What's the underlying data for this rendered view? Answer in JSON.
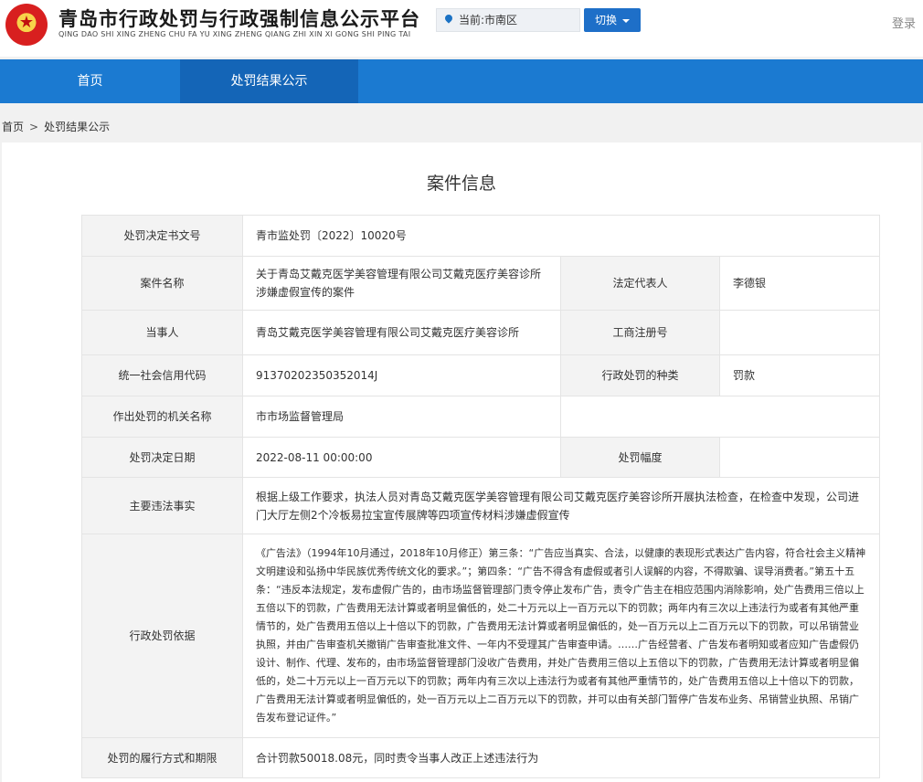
{
  "header": {
    "title": "青岛市行政处罚与行政强制信息公示平台",
    "subtitle": "QING DAO SHI XING ZHENG CHU FA YU XING ZHENG QIANG ZHI XIN XI GONG SHI PING TAI",
    "location": "当前:市南区",
    "switch_label": "切换",
    "login_label": "登录"
  },
  "nav": {
    "items": [
      "首页",
      "处罚结果公示"
    ],
    "active": "处罚结果公示"
  },
  "breadcrumb": {
    "home": "首页",
    "sep": ">",
    "current": "处罚结果公示"
  },
  "page_title": "案件信息",
  "fields": {
    "doc_no_label": "处罚决定书文号",
    "doc_no": "青市监处罚〔2022〕10020号",
    "case_name_label": "案件名称",
    "case_name": "关于青岛艾戴克医学美容管理有限公司艾戴克医疗美容诊所涉嫌虚假宣传的案件",
    "legal_rep_label": "法定代表人",
    "legal_rep": "李德银",
    "party_label": "当事人",
    "party": "青岛艾戴克医学美容管理有限公司艾戴克医疗美容诊所",
    "reg_no_label": "工商注册号",
    "reg_no": "",
    "credit_code_label": "统一社会信用代码",
    "credit_code": "91370202350352014J",
    "penalty_type_label": "行政处罚的种类",
    "penalty_type": "罚款",
    "authority_label": "作出处罚的机关名称",
    "authority": "市市场监督管理局",
    "decision_date_label": "处罚决定日期",
    "decision_date": "2022-08-11 00:00:00",
    "penalty_range_label": "处罚幅度",
    "penalty_range": "",
    "facts_label": "主要违法事实",
    "facts": "根据上级工作要求，执法人员对青岛艾戴克医学美容管理有限公司艾戴克医疗美容诊所开展执法检查，在检查中发现，公司进门大厅左侧2个冷板易拉宝宣传展牌等四项宣传材料涉嫌虚假宣传",
    "basis_label": "行政处罚依据",
    "basis": "《广告法》（1994年10月通过，2018年10月修正）第三条：“广告应当真实、合法，以健康的表现形式表达广告内容，符合社会主义精神文明建设和弘扬中华民族优秀传统文化的要求。”；第四条：“广告不得含有虚假或者引人误解的内容，不得欺骗、误导消费者。”第五十五条：“违反本法规定，发布虚假广告的，由市场监督管理部门责令停止发布广告，责令广告主在相应范围内消除影响，处广告费用三倍以上五倍以下的罚款，广告费用无法计算或者明显偏低的，处二十万元以上一百万元以下的罚款；两年内有三次以上违法行为或者有其他严重情节的，处广告费用五倍以上十倍以下的罚款，广告费用无法计算或者明显偏低的，处一百万元以上二百万元以下的罚款，可以吊销营业执照，并由广告审查机关撤销广告审查批准文件、一年内不受理其广告审查申请。……广告经营者、广告发布者明知或者应知广告虚假仍设计、制作、代理、发布的，由市场监督管理部门没收广告费用，并处广告费用三倍以上五倍以下的罚款，广告费用无法计算或者明显偏低的，处二十万元以上一百万元以下的罚款；两年内有三次以上违法行为或者有其他严重情节的，处广告费用五倍以上十倍以下的罚款，广告费用无法计算或者明显偏低的，处一百万元以上二百万元以下的罚款，并可以由有关部门暂停广告发布业务、吊销营业执照、吊销广告发布登记证件。”",
    "performance_label": "处罚的履行方式和期限",
    "performance": "合计罚款50018.08元，同时责令当事人改正上述违法行为"
  },
  "colors": {
    "nav_bg": "#1b7ad1",
    "nav_active": "#1465b7",
    "switch_bg": "#1e6fc8"
  }
}
